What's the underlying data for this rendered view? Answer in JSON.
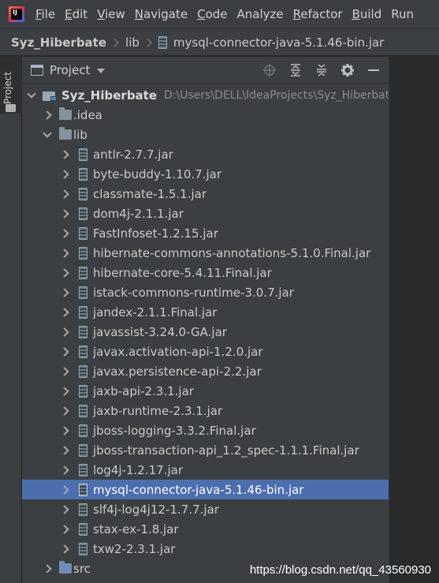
{
  "app": {
    "logo_text": "IJ"
  },
  "menu": {
    "items": [
      {
        "label": "File",
        "mnemonic": "F",
        "rest": "ile"
      },
      {
        "label": "Edit",
        "mnemonic": "E",
        "rest": "dit"
      },
      {
        "label": "View",
        "mnemonic": "V",
        "rest": "iew"
      },
      {
        "label": "Navigate",
        "mnemonic": "N",
        "rest": "avigate"
      },
      {
        "label": "Code",
        "mnemonic": "C",
        "rest": "ode"
      },
      {
        "label": "Analyze",
        "mnemonic": "",
        "rest": "Analyze"
      },
      {
        "label": "Refactor",
        "mnemonic": "R",
        "rest": "efactor"
      },
      {
        "label": "Build",
        "mnemonic": "B",
        "rest": "uild"
      },
      {
        "label": "Run",
        "mnemonic": "",
        "rest": "Run"
      }
    ]
  },
  "breadcrumb": {
    "project": "Syz_Hiberbate",
    "folder": "lib",
    "file": "mysql-connector-java-5.1.46-bin.jar"
  },
  "stripe": {
    "project_tab": "Project"
  },
  "panel": {
    "title": "Project",
    "tools": [
      "locate-icon",
      "expand-all-icon",
      "collapse-all-icon",
      "gear-icon",
      "minimize-icon"
    ]
  },
  "tree": {
    "root": {
      "name": "Syz_Hiberbate",
      "path": "D:\\Users\\DELL\\IdeaProjects\\Syz_Hiberbate"
    },
    "idea": ".idea",
    "lib": "lib",
    "jars": [
      "antlr-2.7.7.jar",
      "byte-buddy-1.10.7.jar",
      "classmate-1.5.1.jar",
      "dom4j-2.1.1.jar",
      "FastInfoset-1.2.15.jar",
      "hibernate-commons-annotations-5.1.0.Final.jar",
      "hibernate-core-5.4.11.Final.jar",
      "istack-commons-runtime-3.0.7.jar",
      "jandex-2.1.1.Final.jar",
      "javassist-3.24.0-GA.jar",
      "javax.activation-api-1.2.0.jar",
      "javax.persistence-api-2.2.jar",
      "jaxb-api-2.3.1.jar",
      "jaxb-runtime-2.3.1.jar",
      "jboss-logging-3.3.2.Final.jar",
      "jboss-transaction-api_1.2_spec-1.1.1.Final.jar",
      "log4j-1.2.17.jar",
      "mysql-connector-java-5.1.46-bin.jar",
      "slf4j-log4j12-1.7.7.jar",
      "stax-ex-1.8.jar",
      "txw2-2.3.1.jar"
    ],
    "selected_jar": "mysql-connector-java-5.1.46-bin.jar",
    "src": "src"
  },
  "watermark": "https://blog.csdn.net/qq_43560930",
  "colors": {
    "selection": "#4b6eaf",
    "panel_bg": "#3c3f41",
    "editor_bg": "#2b2b2b"
  }
}
